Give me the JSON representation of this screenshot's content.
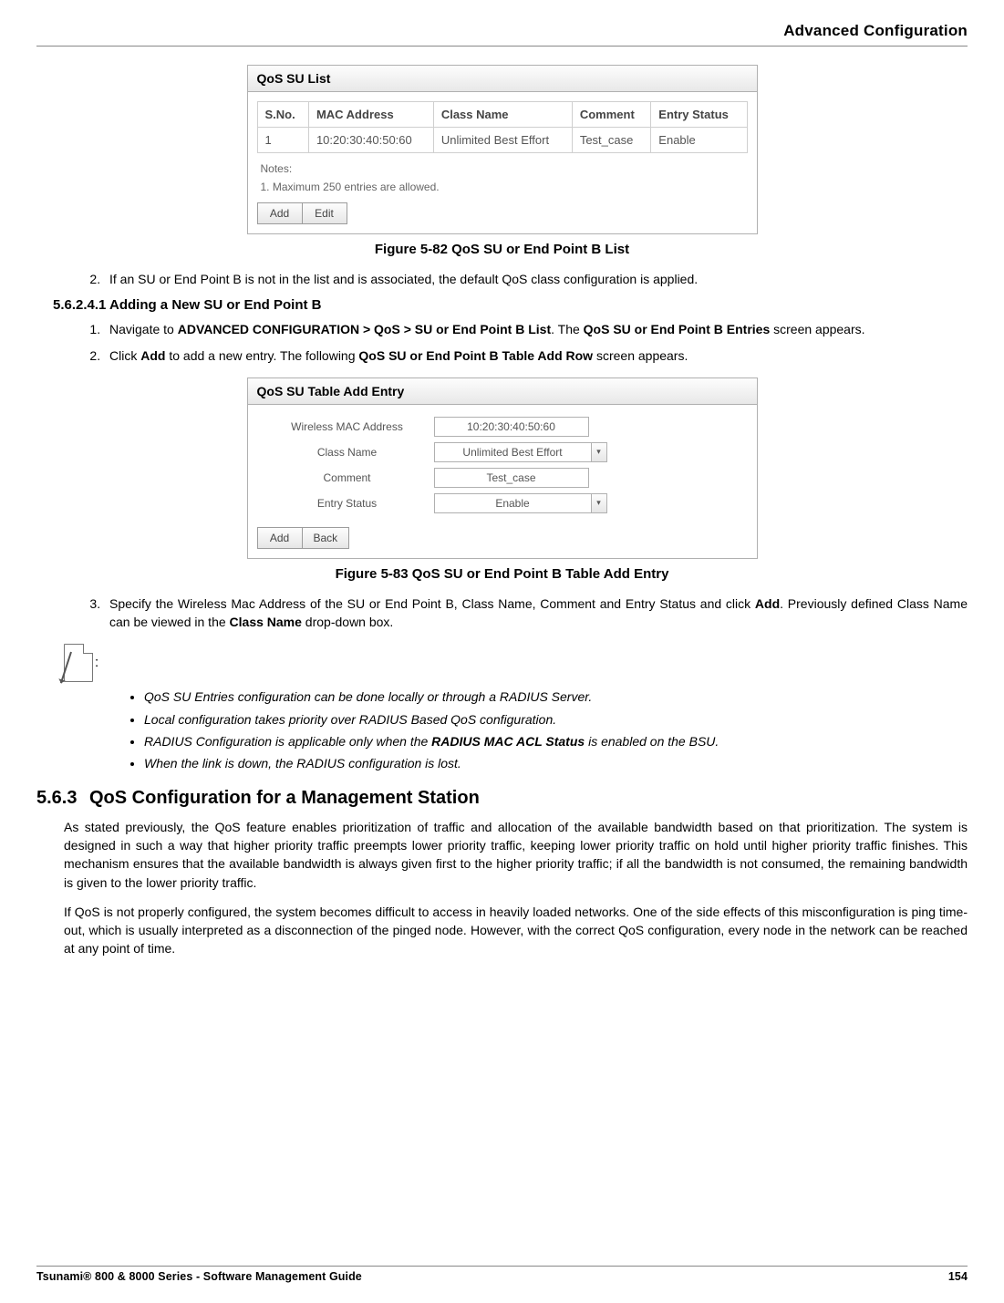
{
  "header": {
    "title": "Advanced Configuration"
  },
  "fig1": {
    "title": "QoS SU List",
    "cols": {
      "c1": "S.No.",
      "c2": "MAC Address",
      "c3": "Class Name",
      "c4": "Comment",
      "c5": "Entry Status"
    },
    "row": {
      "c1": "1",
      "c2": "10:20:30:40:50:60",
      "c3": "Unlimited Best Effort",
      "c4": "Test_case",
      "c5": "Enable"
    },
    "notes_label": "Notes:",
    "notes_line": "1. Maximum 250 entries are allowed.",
    "btn_add": "Add",
    "btn_edit": "Edit",
    "caption": "Figure 5-82 QoS SU or End Point B List"
  },
  "step2": {
    "pre": "If an SU or End Point B is not in the list and is associated, the default QoS class configuration is applied."
  },
  "subhead": "5.6.2.4.1 Adding a New SU or End Point B",
  "s1": {
    "pre": "Navigate to ",
    "b1": "ADVANCED CONFIGURATION > QoS > SU or End Point B List",
    "mid": ". The ",
    "b2": "QoS SU or End Point B Entries",
    "post": " screen appears."
  },
  "s2": {
    "pre": "Click ",
    "b1": "Add",
    "mid": " to add a new entry. The following ",
    "b2": "QoS SU or End Point B Table Add Row",
    "post": " screen appears."
  },
  "fig2": {
    "title": "QoS SU Table Add Entry",
    "l1": "Wireless MAC Address",
    "v1": "10:20:30:40:50:60",
    "l2": "Class Name",
    "v2": "Unlimited Best Effort",
    "l3": "Comment",
    "v3": "Test_case",
    "l4": "Entry Status",
    "v4": "Enable",
    "btn_add": "Add",
    "btn_back": "Back",
    "caption": "Figure 5-83 QoS SU or End Point B Table Add Entry"
  },
  "s3": {
    "pre": "Specify the Wireless Mac Address of the SU or End Point B, Class Name, Comment and Entry Status and click ",
    "b1": "Add",
    "mid": ". Previously defined Class Name can be viewed in the ",
    "b2": "Class Name",
    "post": " drop-down box."
  },
  "notes2": {
    "n1": "QoS SU Entries configuration can be done locally or through a RADIUS Server.",
    "n2": "Local configuration takes priority over RADIUS Based QoS configuration.",
    "n3pre": "RADIUS Configuration is applicable only when the ",
    "n3b": "RADIUS MAC ACL Status",
    "n3post": " is enabled on the BSU.",
    "n4": "When the link is down, the RADIUS configuration is lost."
  },
  "section563": {
    "num": "5.6.3",
    "title": "QoS Configuration for a Management Station",
    "p1": "As stated previously, the QoS feature enables prioritization of traffic and allocation of the available bandwidth based on that prioritization. The system is designed in such a way that higher priority traffic preempts lower priority traffic, keeping lower priority traffic on hold until higher priority traffic finishes. This mechanism ensures that the available bandwidth is always given first to the higher priority traffic; if all the bandwidth is not consumed, the remaining bandwidth is given to the lower priority traffic.",
    "p2": "If QoS is not properly configured, the system becomes difficult to access in heavily loaded networks. One of the side effects of this misconfiguration is ping time-out, which is usually interpreted as a disconnection of the pinged node. However, with the correct QoS configuration, every node in the network can be reached at any point of time."
  },
  "footer": {
    "left": "Tsunami® 800 & 8000 Series - Software Management Guide",
    "right": "154"
  }
}
